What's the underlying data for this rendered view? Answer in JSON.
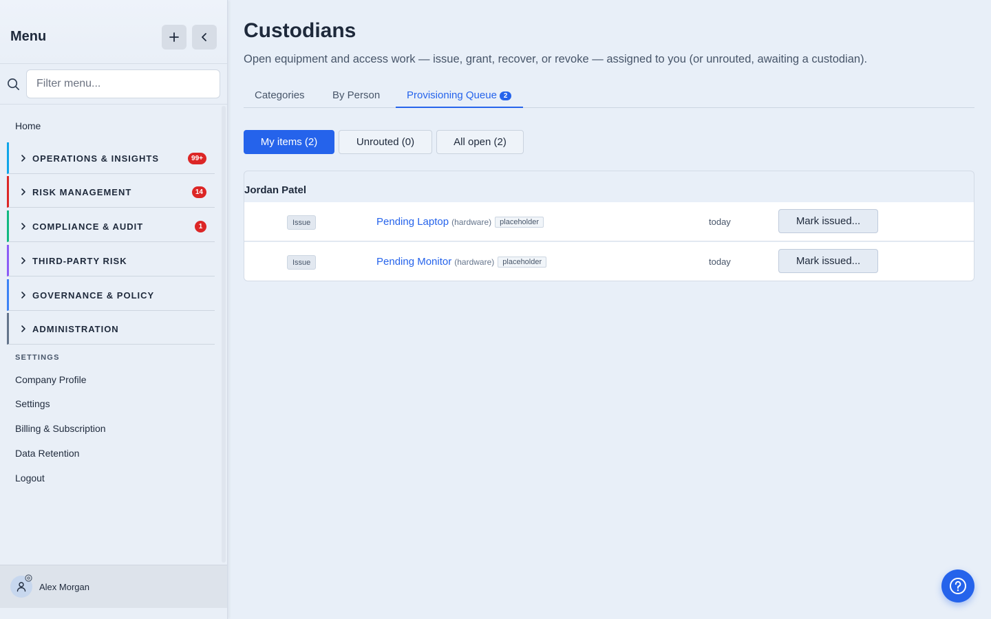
{
  "sidebar": {
    "title": "Menu",
    "filter_placeholder": "Filter menu...",
    "home": "Home",
    "groups": [
      {
        "label": "OPERATIONS & INSIGHTS",
        "badge": "99+",
        "color": "#0ea5e9"
      },
      {
        "label": "RISK MANAGEMENT",
        "badge": "14",
        "color": "#dc2626"
      },
      {
        "label": "COMPLIANCE & AUDIT",
        "badge": "1",
        "color": "#10b981"
      },
      {
        "label": "THIRD-PARTY RISK",
        "badge": "",
        "color": "#8b5cf6"
      },
      {
        "label": "GOVERNANCE & POLICY",
        "badge": "",
        "color": "#3b82f6"
      },
      {
        "label": "ADMINISTRATION",
        "badge": "",
        "color": "#64748b"
      }
    ],
    "settings_heading": "SETTINGS",
    "settings_items": [
      "Company Profile",
      "Settings",
      "Billing & Subscription",
      "Data Retention",
      "Logout"
    ],
    "user_name": "Alex Morgan"
  },
  "main": {
    "title": "Custodians",
    "subtitle": "Open equipment and access work — issue, grant, recover, or revoke — assigned to you (or unrouted, awaiting a custodian).",
    "tabs": [
      {
        "label": "Categories"
      },
      {
        "label": "By Person"
      },
      {
        "label": "Provisioning Queue",
        "count": "2"
      }
    ],
    "filters": [
      "My items (2)",
      "Unrouted (0)",
      "All open (2)"
    ],
    "group_title": "Jordan Patel",
    "rows": [
      {
        "kind": "Issue",
        "name": "Pending Laptop",
        "category": "(hardware)",
        "tag": "placeholder",
        "when": "today",
        "action": "Mark issued..."
      },
      {
        "kind": "Issue",
        "name": "Pending Monitor",
        "category": "(hardware)",
        "tag": "placeholder",
        "when": "today",
        "action": "Mark issued..."
      }
    ]
  },
  "colors": {
    "accent": "#2563eb",
    "badge": "#dc2626"
  }
}
